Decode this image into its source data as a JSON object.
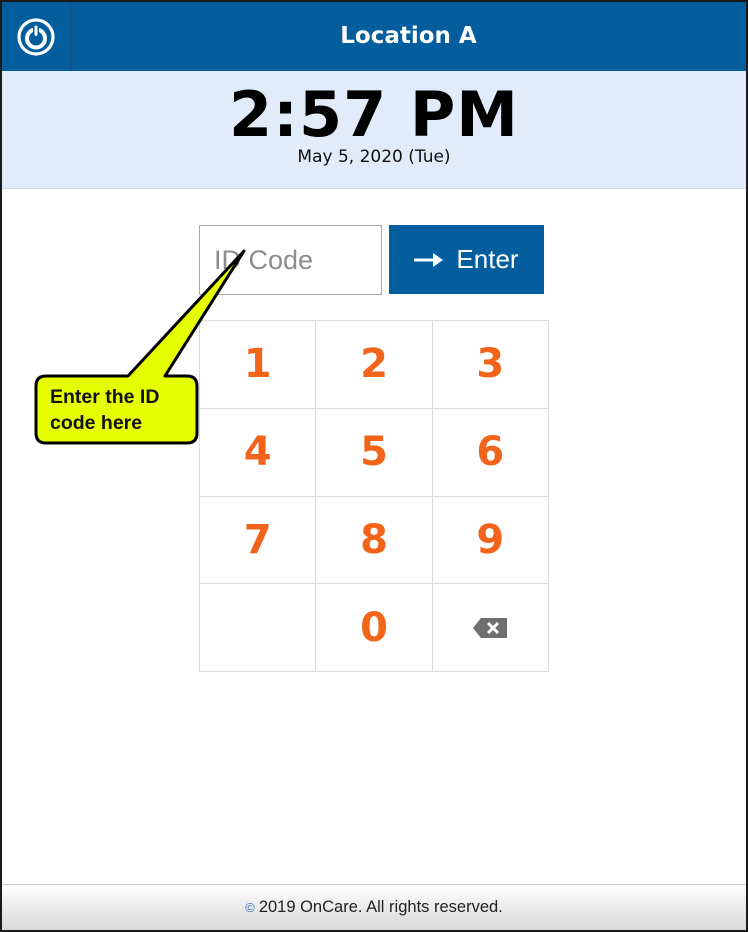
{
  "header": {
    "title": "Location A",
    "power_icon": "power-icon",
    "bg_color": "#045e9e"
  },
  "clock": {
    "time": "2:57 PM",
    "date": "May 5, 2020 (Tue)"
  },
  "login": {
    "id_placeholder": "ID Code",
    "id_value": "",
    "enter_label": "Enter",
    "enter_icon": "arrow-right-icon"
  },
  "keypad": {
    "keys": [
      "1",
      "2",
      "3",
      "4",
      "5",
      "6",
      "7",
      "8",
      "9",
      "",
      "0",
      ""
    ],
    "backspace_icon": "backspace-icon",
    "digit_color": "#f26419"
  },
  "callout": {
    "text": "Enter the ID code here",
    "line1": "Enter the ID",
    "line2": "code here",
    "fill_color": "#e6ff00"
  },
  "footer": {
    "copyright_symbol": "©",
    "text": "2019 OnCare. All rights reserved."
  }
}
